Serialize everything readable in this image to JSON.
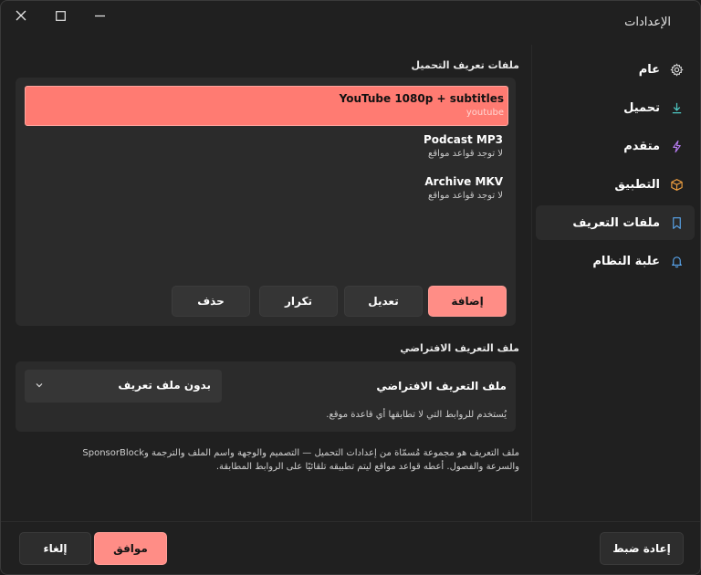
{
  "window": {
    "title": "الإعدادات",
    "close_glyph": "✕",
    "maximize_glyph": "☐",
    "minimize_glyph": "—"
  },
  "sidebar": {
    "items": [
      {
        "label": "عام",
        "icon": "gear-icon"
      },
      {
        "label": "تحميل",
        "icon": "download-icon"
      },
      {
        "label": "متقدم",
        "icon": "bolt-icon"
      },
      {
        "label": "التطبيق",
        "icon": "box-icon"
      },
      {
        "label": "ملفات التعريف",
        "icon": "bookmark-icon",
        "active": true
      },
      {
        "label": "علبة النظام",
        "icon": "bell-icon"
      }
    ]
  },
  "profiles_section": {
    "title": "ملفات تعريف التحميل",
    "profiles": [
      {
        "name": "YouTube 1080p + subtitles",
        "sub": "youtube",
        "selected": true
      },
      {
        "name": "Podcast MP3",
        "sub": "لا توجد قواعد مواقع"
      },
      {
        "name": "Archive MKV",
        "sub": "لا توجد قواعد مواقع"
      }
    ],
    "buttons": {
      "add": "إضافة",
      "edit": "تعديل",
      "duplicate": "تكرار",
      "delete": "حذف"
    }
  },
  "default_section": {
    "title": "ملف التعريف الافتراضي",
    "field_label": "ملف التعريف الافتراضي",
    "select_value": "بدون ملف تعريف",
    "help": "يُستخدم للروابط التي لا تطابقها أي قاعدة موقع."
  },
  "description": {
    "line1": "ملف التعريف هو مجموعة مُسمّاة من إعدادات التحميل — التصميم والوجهة واسم الملف والترجمة وSponsorBlock",
    "line2": "والسرعة والفصول. أعطه قواعد مواقع ليتم تطبيقه تلقائيًا على الروابط المطابقة."
  },
  "footer": {
    "reset": "إعادة ضبط",
    "ok": "موافق",
    "cancel": "إلغاء"
  },
  "colors": {
    "accent": "#ff8d86",
    "selected_row": "#ff7b72",
    "background": "#202020",
    "card": "#2b2b2b"
  }
}
